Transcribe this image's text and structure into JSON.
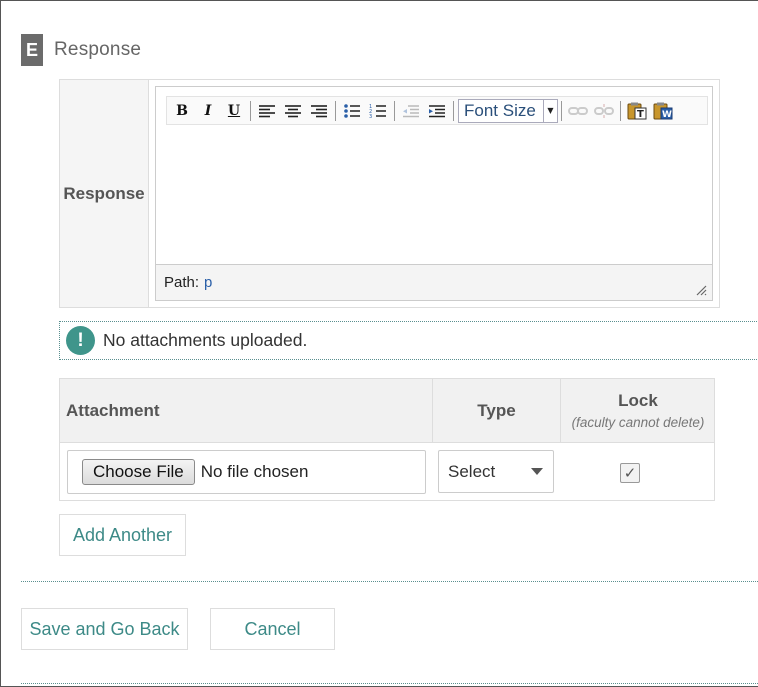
{
  "section": {
    "letter": "E",
    "title": "Response"
  },
  "response_field": {
    "label": "Response",
    "toolbar": {
      "bold": "B",
      "italic": "I",
      "underline": "U",
      "font_size_label": "Font Size"
    },
    "path_label": "Path:",
    "path_value": "p"
  },
  "notice": {
    "icon": "!",
    "text": "No attachments uploaded."
  },
  "attachments": {
    "headers": {
      "attachment": "Attachment",
      "type": "Type",
      "lock": "Lock",
      "lock_note": "(faculty cannot delete)"
    },
    "row": {
      "choose_label": "Choose File",
      "file_status": "No file chosen",
      "type_value": "Select",
      "lock_mark": "✓",
      "lock_checked": true
    }
  },
  "buttons": {
    "add_another": "Add Another",
    "save_back": "Save and Go Back",
    "cancel": "Cancel"
  },
  "colors": {
    "accent": "#3d8a87",
    "notice_icon": "#3f958b",
    "section_badge": "#6b6b6b"
  }
}
